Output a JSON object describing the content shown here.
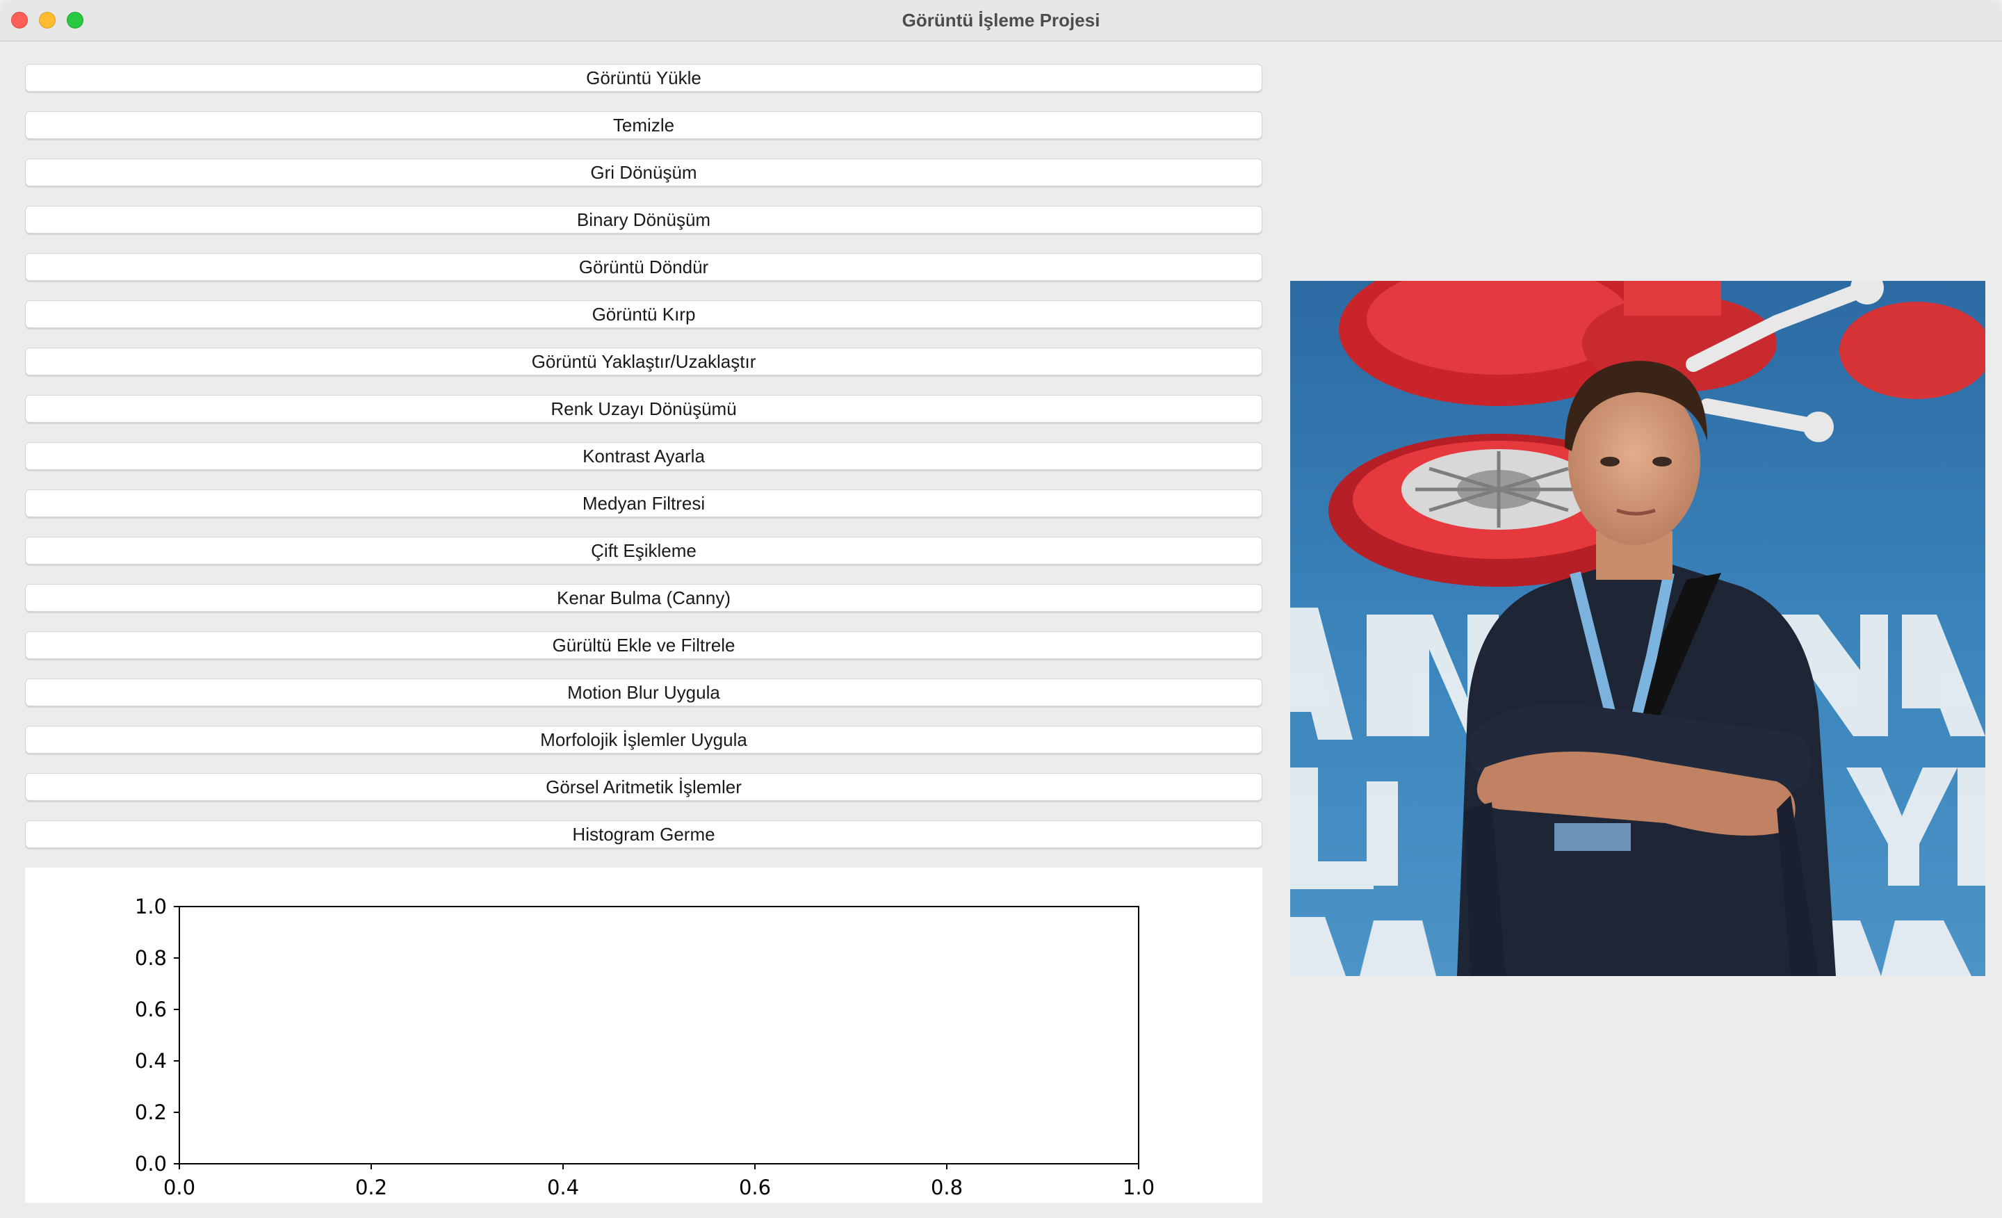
{
  "window": {
    "title": "Görüntü İşleme Projesi"
  },
  "buttons": [
    "Görüntü Yükle",
    "Temizle",
    "Gri Dönüşüm",
    "Binary Dönüşüm",
    "Görüntü Döndür",
    "Görüntü Kırp",
    "Görüntü Yaklaştır/Uzaklaştır",
    "Renk Uzayı Dönüşümü",
    "Kontrast Ayarla",
    "Medyan Filtresi",
    "Çift Eşikleme",
    "Kenar Bulma (Canny)",
    "Gürültü Ekle ve Filtrele",
    "Motion Blur Uygula",
    "Morfolojik İşlemler Uygula",
    "Görsel Aritmetik İşlemler",
    "Histogram Germe"
  ],
  "image_panel": {
    "description_icon": "photo-of-person"
  },
  "chart_data": {
    "type": "line",
    "series": [],
    "xlim": [
      0.0,
      1.0
    ],
    "ylim": [
      0.0,
      1.0
    ],
    "xticks": [
      "0.0",
      "0.2",
      "0.4",
      "0.6",
      "0.8",
      "1.0"
    ],
    "yticks": [
      "0.0",
      "0.2",
      "0.4",
      "0.6",
      "0.8",
      "1.0"
    ],
    "title": "",
    "xlabel": "",
    "ylabel": "",
    "grid": false
  },
  "colors": {
    "window_bg": "#ececec",
    "button_bg": "#ffffff",
    "close": "#ff5f57",
    "minimize": "#febc2e",
    "maximize": "#28c840"
  }
}
